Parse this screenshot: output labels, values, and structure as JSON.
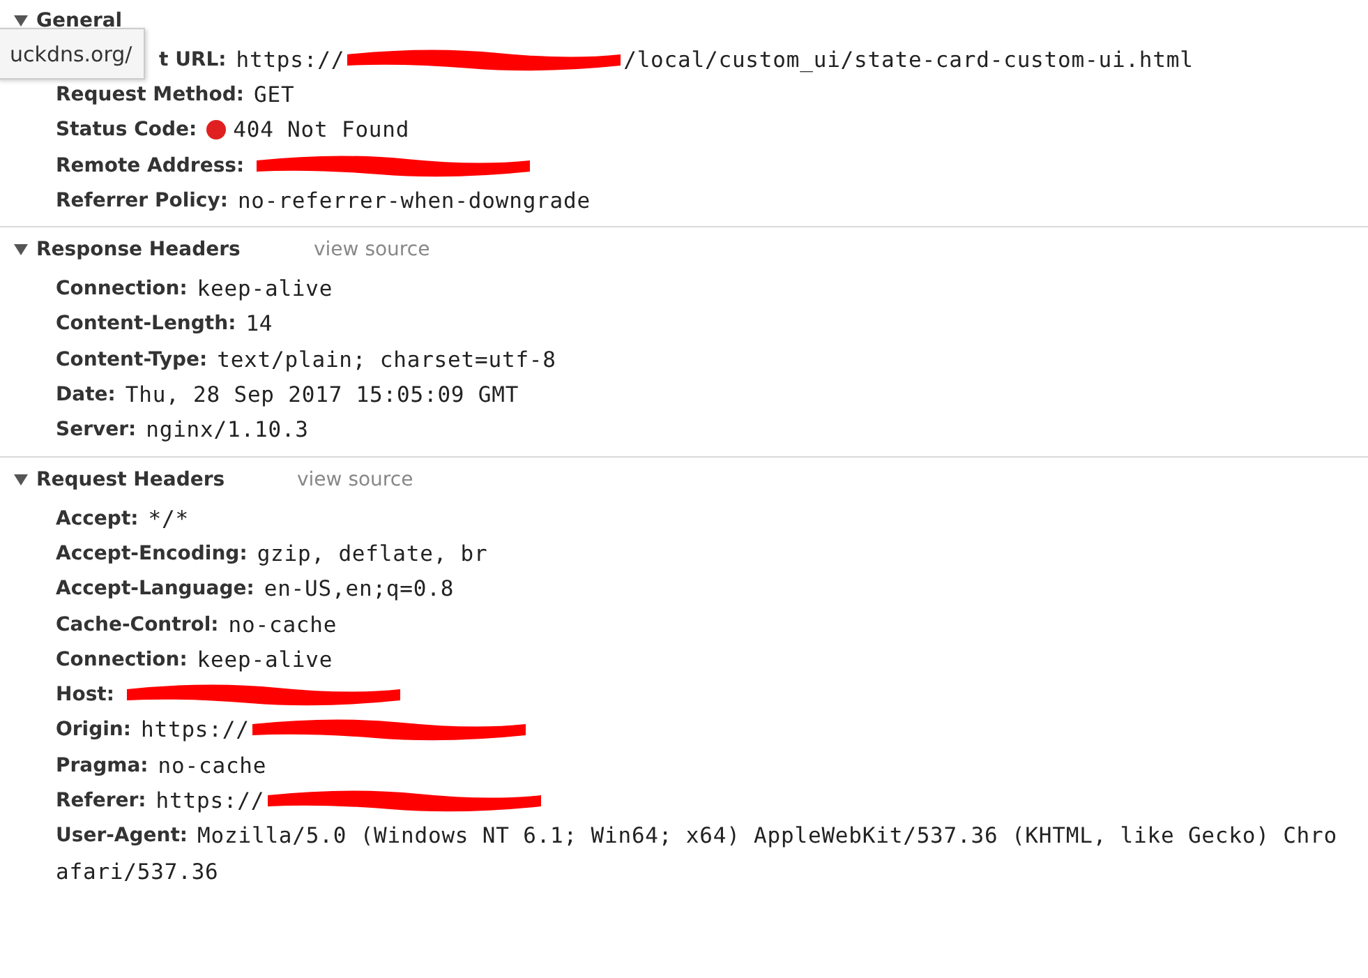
{
  "tooltip": {
    "text": "uckdns.org/"
  },
  "sections": [
    {
      "title": "General",
      "expanded": true,
      "rows": [
        {
          "label": "t URL:",
          "value": [
            {
              "kind": "text",
              "text": "https://"
            },
            {
              "kind": "redaction"
            },
            {
              "kind": "text",
              "text": "/local/custom_ui/state-card-custom-ui.html"
            }
          ]
        },
        {
          "label": "Request Method:",
          "value": [
            {
              "kind": "text",
              "text": "GET"
            }
          ]
        },
        {
          "label": "Status Code:",
          "value": [
            {
              "kind": "status",
              "color": "#e02020"
            },
            {
              "kind": "text",
              "text": "404 Not Found"
            }
          ]
        },
        {
          "label": "Remote Address:",
          "value": [
            {
              "kind": "redaction"
            }
          ]
        },
        {
          "label": "Referrer Policy:",
          "value": [
            {
              "kind": "text",
              "text": "no-referrer-when-downgrade"
            }
          ]
        }
      ]
    },
    {
      "title": "Response Headers",
      "expanded": true,
      "link": "view source",
      "rows": [
        {
          "label": "Connection:",
          "value": [
            {
              "kind": "text",
              "text": "keep-alive"
            }
          ]
        },
        {
          "label": "Content-Length:",
          "value": [
            {
              "kind": "text",
              "text": "14"
            }
          ]
        },
        {
          "label": "Content-Type:",
          "value": [
            {
              "kind": "text",
              "text": "text/plain; charset=utf-8"
            }
          ]
        },
        {
          "label": "Date:",
          "value": [
            {
              "kind": "text",
              "text": "Thu, 28 Sep 2017 15:05:09 GMT"
            }
          ]
        },
        {
          "label": "Server:",
          "value": [
            {
              "kind": "text",
              "text": "nginx/1.10.3"
            }
          ]
        }
      ]
    },
    {
      "title": "Request Headers",
      "expanded": true,
      "link": "view source",
      "rows": [
        {
          "label": "Accept:",
          "value": [
            {
              "kind": "text",
              "text": "*/*"
            }
          ]
        },
        {
          "label": "Accept-Encoding:",
          "value": [
            {
              "kind": "text",
              "text": "gzip, deflate, br"
            }
          ]
        },
        {
          "label": "Accept-Language:",
          "value": [
            {
              "kind": "text",
              "text": "en-US,en;q=0.8"
            }
          ]
        },
        {
          "label": "Cache-Control:",
          "value": [
            {
              "kind": "text",
              "text": "no-cache"
            }
          ]
        },
        {
          "label": "Connection:",
          "value": [
            {
              "kind": "text",
              "text": "keep-alive"
            }
          ]
        },
        {
          "label": "Host:",
          "value": [
            {
              "kind": "redaction"
            }
          ]
        },
        {
          "label": "Origin:",
          "value": [
            {
              "kind": "text",
              "text": "https://"
            },
            {
              "kind": "redaction"
            }
          ]
        },
        {
          "label": "Pragma:",
          "value": [
            {
              "kind": "text",
              "text": "no-cache"
            }
          ]
        },
        {
          "label": "Referer:",
          "value": [
            {
              "kind": "text",
              "text": "https://"
            },
            {
              "kind": "redaction"
            }
          ]
        },
        {
          "label": "User-Agent:",
          "value": [
            {
              "kind": "text",
              "text": "Mozilla/5.0 (Windows NT 6.1; Win64; x64) AppleWebKit/537.36 (KHTML, like Gecko) Chro"
            }
          ],
          "continuation": "afari/537.36"
        }
      ]
    }
  ]
}
